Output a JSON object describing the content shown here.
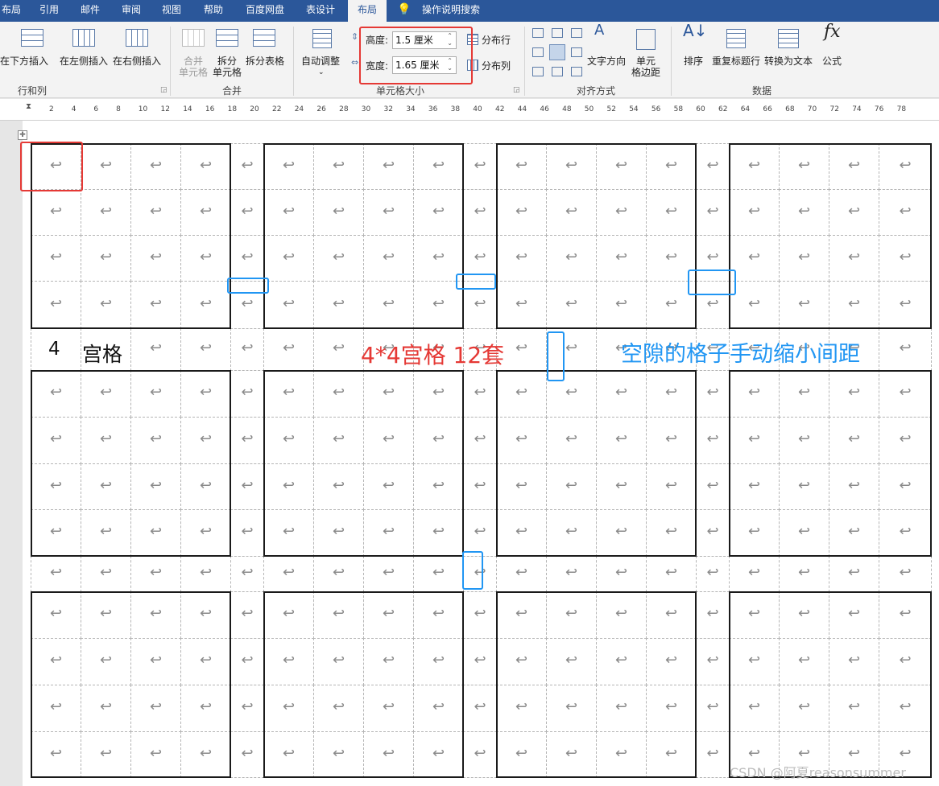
{
  "tabs": [
    "布局",
    "引用",
    "邮件",
    "审阅",
    "视图",
    "帮助",
    "百度网盘",
    "表设计",
    "布局"
  ],
  "tell_me": "操作说明搜索",
  "ribbon": {
    "insert_below": "在下方插入",
    "insert_left": "在左侧插入",
    "insert_right": "在右侧插入",
    "group_rows_cols": "行和列",
    "merge_cells_1": "合并",
    "merge_cells_2": "单元格",
    "split_cells_1": "拆分",
    "split_cells_2": "单元格",
    "split_table": "拆分表格",
    "group_merge": "合并",
    "autofit": "自动调整",
    "height_label": "高度:",
    "height_value": "1.5 厘米",
    "width_label": "宽度:",
    "width_value": "1.65 厘米",
    "distribute_rows": "分布行",
    "distribute_cols": "分布列",
    "group_cell_size": "单元格大小",
    "text_direction": "文字方向",
    "cell_margins_1": "单元",
    "cell_margins_2": "格边距",
    "group_alignment": "对齐方式",
    "sort": "排序",
    "repeat_header": "重复标题行",
    "convert_text": "转换为文本",
    "formula": "公式",
    "group_data": "数据"
  },
  "ruler_numbers": [
    "2",
    "4",
    "6",
    "8",
    "10",
    "12",
    "14",
    "16",
    "18",
    "20",
    "22",
    "24",
    "26",
    "28",
    "30",
    "32",
    "34",
    "36",
    "38",
    "40",
    "42",
    "44",
    "46",
    "48",
    "50",
    "52",
    "54",
    "56",
    "58",
    "60",
    "62",
    "64",
    "66",
    "68",
    "70",
    "72",
    "74",
    "76",
    "78"
  ],
  "document": {
    "return_glyph": "↩",
    "label_4": "4",
    "label_gongge": "宫格",
    "annotation_red": "4*4宫格 12套",
    "annotation_blue": "空隙的格子手动缩小间距",
    "watermark": "CSDN @阿夏reasonsummer"
  },
  "colors": {
    "accent": "#2b579a",
    "annotation_red": "#e53935",
    "annotation_blue": "#2196f3"
  }
}
